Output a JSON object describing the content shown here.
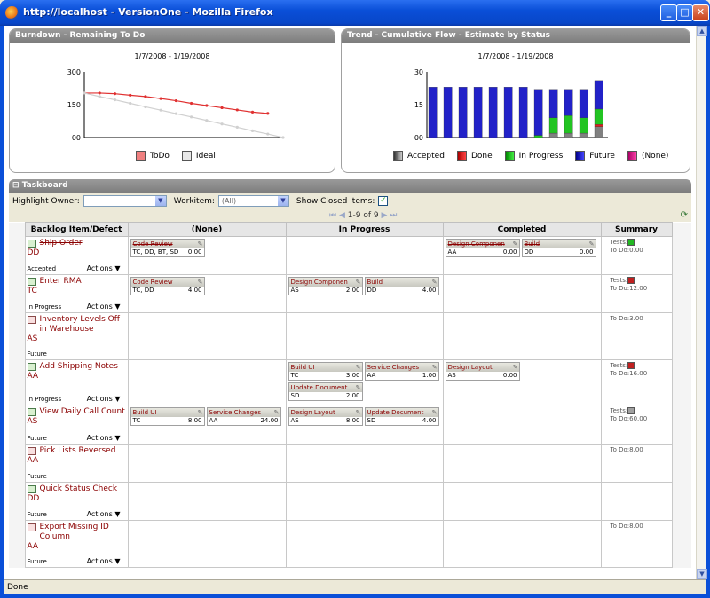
{
  "window": {
    "title": "http://localhost - VersionOne - Mozilla Firefox",
    "minimize": "_",
    "maximize": "□",
    "close": "✕"
  },
  "burndown": {
    "title": "Burndown - Remaining To Do",
    "subtitle": "1/7/2008 - 1/19/2008",
    "legend": [
      "ToDo",
      "Ideal"
    ],
    "colors": {
      "todo": "#e03030",
      "ideal": "#d0d0d0"
    }
  },
  "trend": {
    "title": "Trend - Cumulative Flow - Estimate by Status",
    "subtitle": "1/7/2008 - 1/19/2008",
    "legend": [
      "Accepted",
      "Done",
      "In Progress",
      "Future",
      "(None)"
    ],
    "colors": [
      "#808080",
      "#e02020",
      "#22c422",
      "#2222c8",
      "#d02090"
    ]
  },
  "chart_data": [
    {
      "type": "line",
      "title": "Burndown - Remaining To Do",
      "subtitle": "1/7/2008 - 1/19/2008",
      "yticks": [
        "300",
        "150",
        "00"
      ],
      "ylim": [
        0,
        300
      ],
      "x": [
        1,
        2,
        3,
        4,
        5,
        6,
        7,
        8,
        9,
        10,
        11,
        12,
        13,
        14
      ],
      "series": [
        {
          "name": "ToDo",
          "values": [
            203,
            203,
            200,
            193,
            187,
            178,
            168,
            156,
            146,
            136,
            126,
            116,
            110,
            null
          ]
        },
        {
          "name": "Ideal",
          "values": [
            203,
            187,
            172,
            156,
            140,
            125,
            109,
            94,
            78,
            62,
            47,
            31,
            16,
            0
          ]
        }
      ]
    },
    {
      "type": "bar",
      "stacked": true,
      "title": "Trend - Cumulative Flow - Estimate by Status",
      "subtitle": "1/7/2008 - 1/19/2008",
      "yticks": [
        "30",
        "15",
        "00"
      ],
      "ylim": [
        0,
        30
      ],
      "categories": [
        "1",
        "2",
        "3",
        "4",
        "5",
        "6",
        "7",
        "8",
        "9",
        "10",
        "11",
        "12"
      ],
      "series": [
        {
          "name": "Accepted",
          "values": [
            0,
            0,
            0,
            0,
            0,
            0,
            0,
            0,
            2,
            2,
            2,
            5
          ]
        },
        {
          "name": "Done",
          "values": [
            0,
            0,
            0,
            0,
            0,
            0,
            0,
            0,
            0,
            0,
            0,
            1
          ]
        },
        {
          "name": "In Progress",
          "values": [
            0,
            0,
            0,
            0,
            0,
            0,
            0,
            1,
            7,
            8,
            7,
            7
          ]
        },
        {
          "name": "Future",
          "values": [
            23,
            23,
            23,
            23,
            23,
            23,
            23,
            21,
            13,
            12,
            13,
            13
          ]
        },
        {
          "name": "(None)",
          "values": [
            0,
            0,
            0,
            0,
            0,
            0,
            0,
            0,
            0,
            0,
            0,
            0
          ]
        }
      ]
    }
  ],
  "taskboard": {
    "title": "Taskboard",
    "collapse": "⊟",
    "highlight_label": "Highlight Owner:",
    "highlight_value": "",
    "workitem_label": "Workitem:",
    "workitem_value": "(All)",
    "closed_label": "Show Closed Items:",
    "closed_check": "✓",
    "pager": "1-9 of 9",
    "first": "⏮",
    "prev": "◀",
    "next": "▶",
    "last": "⏭",
    "refresh": "⟳",
    "columns": [
      "Backlog Item/Defect",
      "(None)",
      "In Progress",
      "Completed",
      "Summary"
    ],
    "actions_label": "Actions",
    "actions_arrow": "▼",
    "edit_glyph": "✎",
    "tests_label": "Tests:",
    "todo_label": "To Do:",
    "rows": [
      {
        "title": "Ship Order",
        "owner": "DD",
        "status": "Accepted",
        "struck": true,
        "defect": false,
        "actions": true,
        "none": [
          {
            "name": "Code Review",
            "owner": "TC, DD, BT, SD",
            "todo": "0.00",
            "done": true
          }
        ],
        "inprog": [],
        "completed": [
          {
            "name": "Design Componen",
            "owner": "AA",
            "todo": "0.00",
            "done": true
          },
          {
            "name": "Build",
            "owner": "DD",
            "todo": "0.00",
            "done": true
          }
        ],
        "tests": "#22b822",
        "summary_todo": "0.00"
      },
      {
        "title": "Enter RMA",
        "owner": "TC",
        "status": "In Progress",
        "struck": false,
        "defect": false,
        "actions": true,
        "none": [
          {
            "name": "Code Review",
            "owner": "TC, DD",
            "todo": "4.00"
          }
        ],
        "inprog": [
          {
            "name": "Design Componen",
            "owner": "AS",
            "todo": "2.00"
          },
          {
            "name": "Build",
            "owner": "DD",
            "todo": "4.00"
          }
        ],
        "completed": [],
        "tests": "#c02020",
        "summary_todo": "12.00"
      },
      {
        "title": "Inventory Levels Off in Warehouse",
        "owner": "AS",
        "status": "Future",
        "struck": false,
        "defect": true,
        "actions": false,
        "none": [],
        "inprog": [],
        "completed": [],
        "tests": null,
        "summary_todo": "3.00"
      },
      {
        "title": "Add Shipping Notes",
        "owner": "AA",
        "status": "In Progress",
        "struck": false,
        "defect": false,
        "actions": true,
        "none": [],
        "inprog": [
          {
            "name": "Build UI",
            "owner": "TC",
            "todo": "3.00"
          },
          {
            "name": "Service Changes",
            "owner": "AA",
            "todo": "1.00"
          },
          {
            "name": "Update Document",
            "owner": "SD",
            "todo": "2.00"
          }
        ],
        "completed": [
          {
            "name": "Design Layout",
            "owner": "AS",
            "todo": "0.00"
          }
        ],
        "tests": "#c02020",
        "summary_todo": "16.00"
      },
      {
        "title": "View Daily Call Count",
        "owner": "AS",
        "status": "Future",
        "struck": false,
        "defect": false,
        "actions": true,
        "none": [
          {
            "name": "Build UI",
            "owner": "TC",
            "todo": "8.00"
          },
          {
            "name": "Service Changes",
            "owner": "AA",
            "todo": "24.00"
          }
        ],
        "inprog": [
          {
            "name": "Design Layout",
            "owner": "AS",
            "todo": "8.00"
          },
          {
            "name": "Update Document",
            "owner": "SD",
            "todo": "4.00"
          }
        ],
        "completed": [],
        "tests": "#a0a0a0",
        "summary_todo": "60.00"
      },
      {
        "title": "Pick Lists Reversed",
        "owner": "AA",
        "status": "Future",
        "struck": false,
        "defect": true,
        "actions": false,
        "none": [],
        "inprog": [],
        "completed": [],
        "tests": null,
        "summary_todo": "8.00"
      },
      {
        "title": "Quick Status Check",
        "owner": "DD",
        "status": "Future",
        "struck": false,
        "defect": false,
        "actions": true,
        "none": [],
        "inprog": [],
        "completed": [],
        "tests": null,
        "summary_todo": null
      },
      {
        "title": "Export Missing ID Column",
        "owner": "AA",
        "status": "Future",
        "struck": false,
        "defect": true,
        "actions": true,
        "none": [],
        "inprog": [],
        "completed": [],
        "tests": null,
        "summary_todo": "8.00"
      }
    ]
  },
  "status": "Done"
}
